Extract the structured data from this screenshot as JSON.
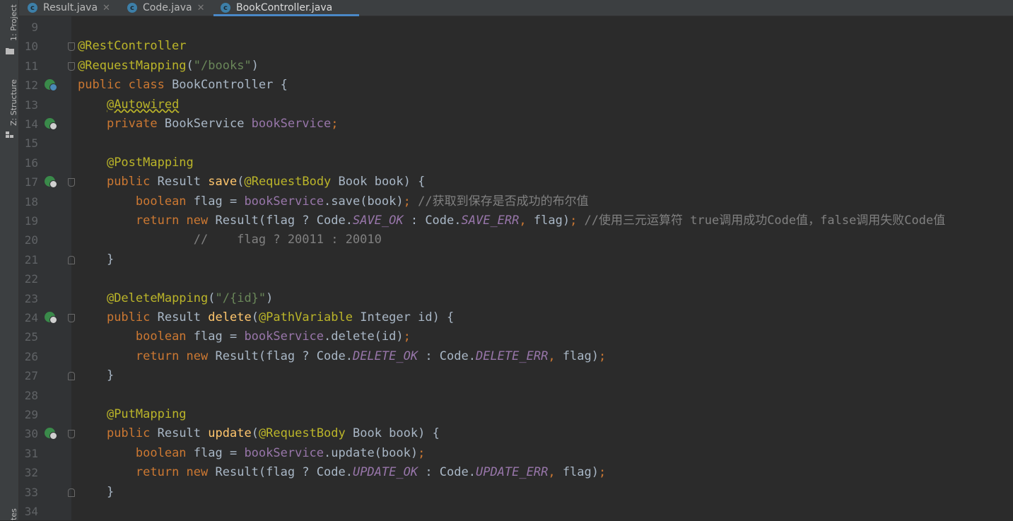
{
  "side_panel": {
    "project_label": "1: Project",
    "structure_label": "Z: Structure",
    "bottom_label": "tes"
  },
  "tabs": [
    {
      "label": "Result.java",
      "icon": "class-icon",
      "active": false
    },
    {
      "label": "Code.java",
      "icon": "class-icon",
      "active": false
    },
    {
      "label": "BookController.java",
      "icon": "class-icon",
      "active": true
    }
  ],
  "editor": {
    "lines": [
      {
        "num": "9",
        "html": ""
      },
      {
        "num": "10",
        "html": "<span class=\"ann\">@RestController</span>"
      },
      {
        "num": "11",
        "html": "<span class=\"ann\">@RequestMapping</span>(<span class=\"str\">\"/books\"</span>)"
      },
      {
        "num": "12",
        "html": "<span class=\"kw\">public class </span>BookController {"
      },
      {
        "num": "13",
        "html": "    <span class=\"ann warn\">@Autowired</span>"
      },
      {
        "num": "14",
        "html": "    <span class=\"kw\">private </span>BookService <span class=\"fld\">bookService</span><span class=\"semi\">;</span>"
      },
      {
        "num": "15",
        "html": ""
      },
      {
        "num": "16",
        "html": "    <span class=\"ann\">@PostMapping</span>"
      },
      {
        "num": "17",
        "html": "    <span class=\"kw\">public </span>Result <span class=\"mth\">save</span>(<span class=\"ann\">@RequestBody </span>Book book) {"
      },
      {
        "num": "18",
        "html": "        <span class=\"kw\">boolean </span>flag = <span class=\"fld\">bookService</span>.save(book)<span class=\"semi\">; </span><span class=\"cm\">//获取到保存是否成功的布尔值</span>"
      },
      {
        "num": "19",
        "html": "        <span class=\"kw\">return new </span>Result(flag ? Code.<span class=\"ifld\">SAVE_OK</span> : Code.<span class=\"ifld\">SAVE_ERR</span><span class=\"semi\">, </span>flag)<span class=\"semi\">; </span><span class=\"cm\">//使用三元运算符 true调用成功Code值，false调用失败Code值</span>"
      },
      {
        "num": "20",
        "html": "                <span class=\"cm\">//    flag ? 20011 : 20010</span>"
      },
      {
        "num": "21",
        "html": "    }"
      },
      {
        "num": "22",
        "html": ""
      },
      {
        "num": "23",
        "html": "    <span class=\"ann\">@DeleteMapping</span>(<span class=\"str\">\"/{id}\"</span>)"
      },
      {
        "num": "24",
        "html": "    <span class=\"kw\">public </span>Result <span class=\"mth\">delete</span>(<span class=\"ann\">@PathVariable </span>Integer id) {"
      },
      {
        "num": "25",
        "html": "        <span class=\"kw\">boolean </span>flag = <span class=\"fld\">bookService</span>.delete(id)<span class=\"semi\">;</span>"
      },
      {
        "num": "26",
        "html": "        <span class=\"kw\">return new </span>Result(flag ? Code.<span class=\"ifld\">DELETE_OK</span> : Code.<span class=\"ifld\">DELETE_ERR</span><span class=\"semi\">, </span>flag)<span class=\"semi\">;</span>"
      },
      {
        "num": "27",
        "html": "    }"
      },
      {
        "num": "28",
        "html": ""
      },
      {
        "num": "29",
        "html": "    <span class=\"ann\">@PutMapping</span>"
      },
      {
        "num": "30",
        "html": "    <span class=\"kw\">public </span>Result <span class=\"mth\">update</span>(<span class=\"ann\">@RequestBody </span>Book book) {"
      },
      {
        "num": "31",
        "html": "        <span class=\"kw\">boolean </span>flag = <span class=\"fld\">bookService</span>.update(book)<span class=\"semi\">;</span>"
      },
      {
        "num": "32",
        "html": "        <span class=\"kw\">return new </span>Result(flag ? Code.<span class=\"ifld\">UPDATE_OK</span> : Code.<span class=\"ifld\">UPDATE_ERR</span><span class=\"semi\">, </span>flag)<span class=\"semi\">;</span>"
      },
      {
        "num": "33",
        "html": "    }"
      },
      {
        "num": "34",
        "html": ""
      }
    ]
  }
}
